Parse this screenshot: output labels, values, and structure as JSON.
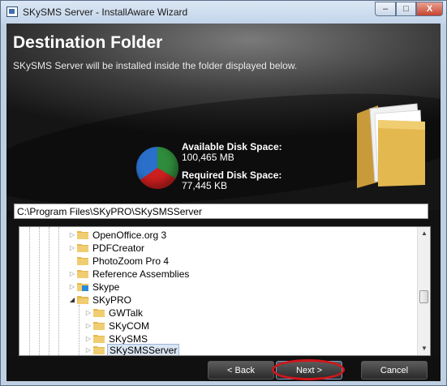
{
  "window": {
    "title": "SKySMS Server - InstallAware Wizard",
    "min_symbol": "–",
    "max_symbol": "□",
    "close_symbol": "X"
  },
  "header": {
    "title": "Destination Folder",
    "subtitle": "SKySMS Server will be installed inside the folder displayed below."
  },
  "disk": {
    "available_label": "Available Disk Space:",
    "available_value": "100,465 MB",
    "required_label": "Required Disk Space:",
    "required_value": "77,445 KB",
    "pie_colors": [
      "#2f8c3c",
      "#cc1f1f",
      "#2a6fc9"
    ]
  },
  "path": {
    "value": "C:\\Program Files\\SKyPRO\\SKySMSServer"
  },
  "tree": {
    "items": [
      {
        "label": "OpenOffice.org 3",
        "expander": "▷",
        "icon": "folder-icon"
      },
      {
        "label": "PDFCreator",
        "expander": "▷",
        "icon": "folder-icon"
      },
      {
        "label": "PhotoZoom Pro 4",
        "expander": "",
        "icon": "folder-icon"
      },
      {
        "label": "Reference Assemblies",
        "expander": "▷",
        "icon": "folder-icon"
      },
      {
        "label": "Skype",
        "expander": "▷",
        "icon": "skype-folder-icon"
      },
      {
        "label": "SKyPRO",
        "expander": "◢",
        "icon": "folder-icon"
      },
      {
        "label": "GWTalk",
        "expander": "▷",
        "icon": "folder-icon"
      },
      {
        "label": "SKyCOM",
        "expander": "▷",
        "icon": "folder-icon"
      },
      {
        "label": "SKySMS",
        "expander": "▷",
        "icon": "folder-icon"
      },
      {
        "label": "SKySMSServer",
        "expander": "▷",
        "icon": "folder-icon",
        "selected": true
      }
    ],
    "scroll_up": "▲",
    "scroll_down": "▼"
  },
  "buttons": {
    "back": "< Back",
    "next": "Next >",
    "cancel": "Cancel"
  },
  "colors": {
    "annotation": "#d1161a",
    "folder": "#e3b84f"
  }
}
